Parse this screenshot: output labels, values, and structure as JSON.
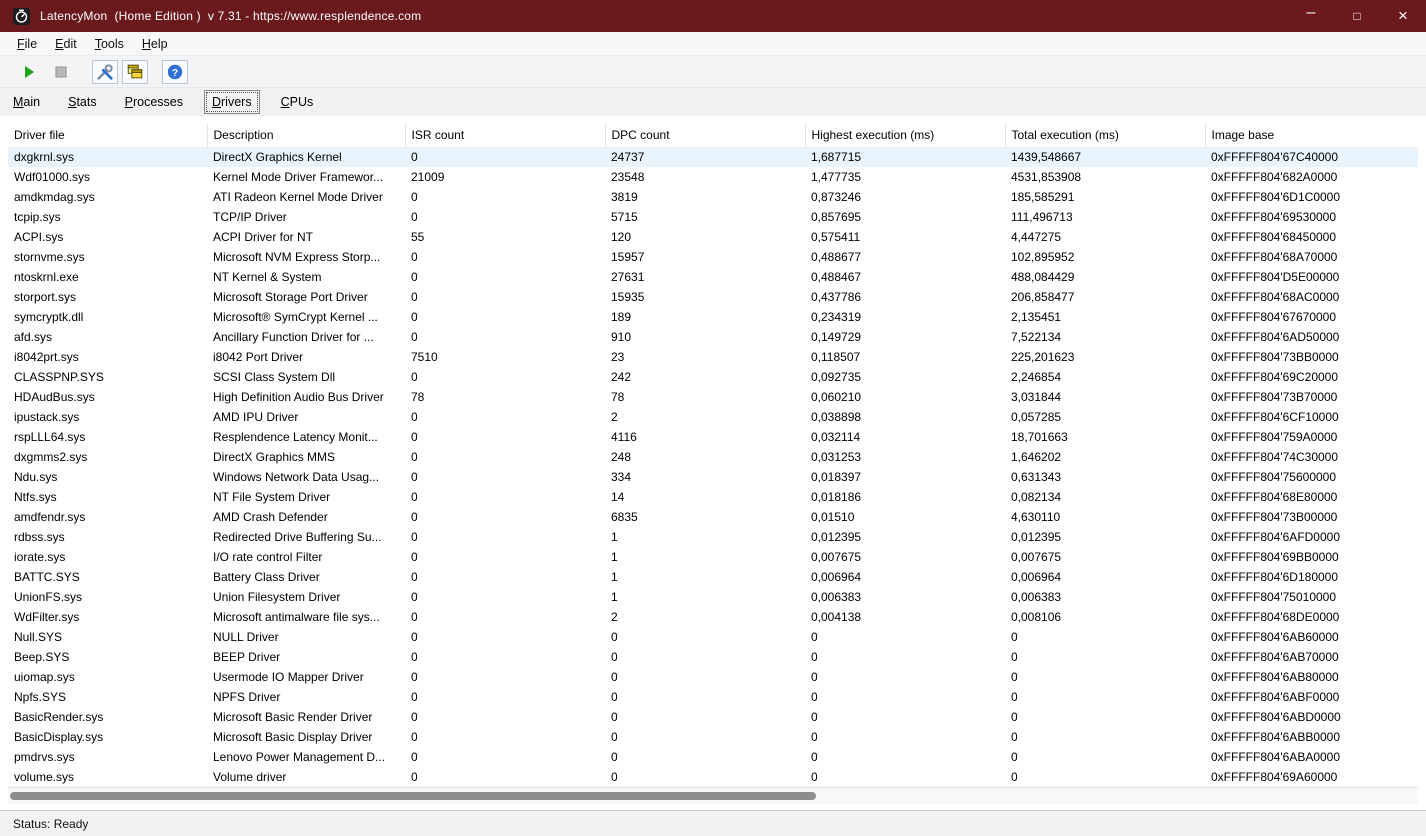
{
  "colors": {
    "titlebar": "#6a191c",
    "selection": "#e8f4fd",
    "play_green": "#1aa51a",
    "help_blue": "#2f6fd6"
  },
  "titlebar": {
    "title": "LatencyMon  (Home Edition )  v 7.31 - https://www.resplendence.com",
    "minimize": "–",
    "maximize": "□",
    "close": "×"
  },
  "menubar": {
    "items": [
      "File",
      "Edit",
      "Tools",
      "Help"
    ]
  },
  "toolbar": {
    "help_glyph": "?"
  },
  "tabs": {
    "items": [
      "Main",
      "Stats",
      "Processes",
      "Drivers",
      "CPUs"
    ],
    "active_index": 3
  },
  "table": {
    "columns": [
      "Driver file",
      "Description",
      "ISR count",
      "DPC count",
      "Highest execution (ms)",
      "Total execution (ms)",
      "Image base"
    ],
    "selected_index": 0,
    "rows": [
      [
        "dxgkrnl.sys",
        "DirectX Graphics Kernel",
        "0",
        "24737",
        "1,687715",
        "1439,548667",
        "0xFFFFF804'67C40000"
      ],
      [
        "Wdf01000.sys",
        "Kernel Mode Driver Framewor...",
        "21009",
        "23548",
        "1,477735",
        "4531,853908",
        "0xFFFFF804'682A0000"
      ],
      [
        "amdkmdag.sys",
        "ATI Radeon Kernel Mode Driver",
        "0",
        "3819",
        "0,873246",
        "185,585291",
        "0xFFFFF804'6D1C0000"
      ],
      [
        "tcpip.sys",
        "TCP/IP Driver",
        "0",
        "5715",
        "0,857695",
        "111,496713",
        "0xFFFFF804'69530000"
      ],
      [
        "ACPI.sys",
        "ACPI Driver for NT",
        "55",
        "120",
        "0,575411",
        "4,447275",
        "0xFFFFF804'68450000"
      ],
      [
        "stornvme.sys",
        "Microsoft NVM Express Storp...",
        "0",
        "15957",
        "0,488677",
        "102,895952",
        "0xFFFFF804'68A70000"
      ],
      [
        "ntoskrnl.exe",
        "NT Kernel & System",
        "0",
        "27631",
        "0,488467",
        "488,084429",
        "0xFFFFF804'D5E00000"
      ],
      [
        "storport.sys",
        "Microsoft Storage Port Driver",
        "0",
        "15935",
        "0,437786",
        "206,858477",
        "0xFFFFF804'68AC0000"
      ],
      [
        "symcryptk.dll",
        "Microsoft® SymCrypt Kernel ...",
        "0",
        "189",
        "0,234319",
        "2,135451",
        "0xFFFFF804'67670000"
      ],
      [
        "afd.sys",
        "Ancillary Function Driver for ...",
        "0",
        "910",
        "0,149729",
        "7,522134",
        "0xFFFFF804'6AD50000"
      ],
      [
        "i8042prt.sys",
        "i8042 Port Driver",
        "7510",
        "23",
        "0,118507",
        "225,201623",
        "0xFFFFF804'73BB0000"
      ],
      [
        "CLASSPNP.SYS",
        "SCSI Class System Dll",
        "0",
        "242",
        "0,092735",
        "2,246854",
        "0xFFFFF804'69C20000"
      ],
      [
        "HDAudBus.sys",
        "High Definition Audio Bus Driver",
        "78",
        "78",
        "0,060210",
        "3,031844",
        "0xFFFFF804'73B70000"
      ],
      [
        "ipustack.sys",
        "AMD IPU Driver",
        "0",
        "2",
        "0,038898",
        "0,057285",
        "0xFFFFF804'6CF10000"
      ],
      [
        "rspLLL64.sys",
        "Resplendence Latency Monit...",
        "0",
        "4116",
        "0,032114",
        "18,701663",
        "0xFFFFF804'759A0000"
      ],
      [
        "dxgmms2.sys",
        "DirectX Graphics MMS",
        "0",
        "248",
        "0,031253",
        "1,646202",
        "0xFFFFF804'74C30000"
      ],
      [
        "Ndu.sys",
        "Windows Network Data Usag...",
        "0",
        "334",
        "0,018397",
        "0,631343",
        "0xFFFFF804'75600000"
      ],
      [
        "Ntfs.sys",
        "NT File System Driver",
        "0",
        "14",
        "0,018186",
        "0,082134",
        "0xFFFFF804'68E80000"
      ],
      [
        "amdfendr.sys",
        "AMD Crash Defender",
        "0",
        "6835",
        "0,01510",
        "4,630110",
        "0xFFFFF804'73B00000"
      ],
      [
        "rdbss.sys",
        "Redirected Drive Buffering Su...",
        "0",
        "1",
        "0,012395",
        "0,012395",
        "0xFFFFF804'6AFD0000"
      ],
      [
        "iorate.sys",
        "I/O rate control Filter",
        "0",
        "1",
        "0,007675",
        "0,007675",
        "0xFFFFF804'69BB0000"
      ],
      [
        "BATTC.SYS",
        "Battery Class Driver",
        "0",
        "1",
        "0,006964",
        "0,006964",
        "0xFFFFF804'6D180000"
      ],
      [
        "UnionFS.sys",
        "Union Filesystem Driver",
        "0",
        "1",
        "0,006383",
        "0,006383",
        "0xFFFFF804'75010000"
      ],
      [
        "WdFilter.sys",
        "Microsoft antimalware file sys...",
        "0",
        "2",
        "0,004138",
        "0,008106",
        "0xFFFFF804'68DE0000"
      ],
      [
        "Null.SYS",
        "NULL Driver",
        "0",
        "0",
        "0",
        "0",
        "0xFFFFF804'6AB60000"
      ],
      [
        "Beep.SYS",
        "BEEP Driver",
        "0",
        "0",
        "0",
        "0",
        "0xFFFFF804'6AB70000"
      ],
      [
        "uiomap.sys",
        "Usermode IO Mapper Driver",
        "0",
        "0",
        "0",
        "0",
        "0xFFFFF804'6AB80000"
      ],
      [
        "Npfs.SYS",
        "NPFS Driver",
        "0",
        "0",
        "0",
        "0",
        "0xFFFFF804'6ABF0000"
      ],
      [
        "BasicRender.sys",
        "Microsoft Basic Render Driver",
        "0",
        "0",
        "0",
        "0",
        "0xFFFFF804'6ABD0000"
      ],
      [
        "BasicDisplay.sys",
        "Microsoft Basic Display Driver",
        "0",
        "0",
        "0",
        "0",
        "0xFFFFF804'6ABB0000"
      ],
      [
        "pmdrvs.sys",
        "Lenovo Power Management D...",
        "0",
        "0",
        "0",
        "0",
        "0xFFFFF804'6ABA0000"
      ],
      [
        "volume.sys",
        "Volume driver",
        "0",
        "0",
        "0",
        "0",
        "0xFFFFF804'69A60000"
      ]
    ]
  },
  "statusbar": {
    "text": "Status: Ready"
  }
}
